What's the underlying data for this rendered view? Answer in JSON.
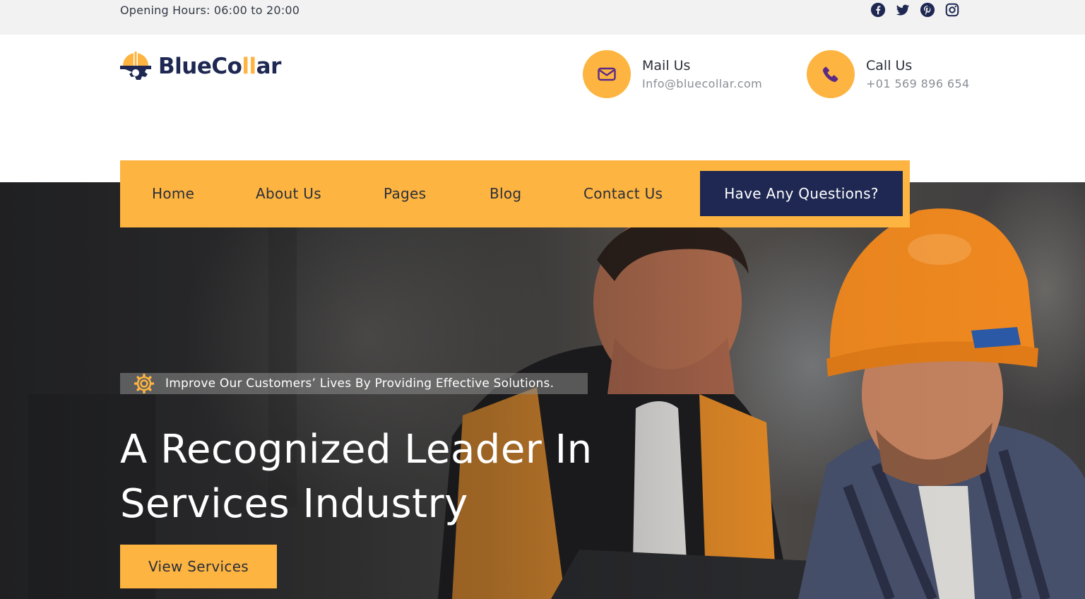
{
  "topbar": {
    "opening_hours": "Opening Hours: 06:00 to 20:00",
    "social": [
      "facebook-icon",
      "twitter-icon",
      "pinterest-icon",
      "instagram-icon"
    ]
  },
  "brand": {
    "name_part1": "BlueCo",
    "name_accent": "ll",
    "name_part2": "ar",
    "colors": {
      "navy": "#1e2852",
      "accent": "#fdb441"
    }
  },
  "contacts": {
    "mail": {
      "icon": "envelope-icon",
      "title": "Mail Us",
      "value": "Info@bluecollar.com"
    },
    "call": {
      "icon": "phone-icon",
      "title": "Call Us",
      "value": "+01 569 896 654"
    }
  },
  "nav": {
    "items": [
      {
        "label": "Home"
      },
      {
        "label": "About Us"
      },
      {
        "label": "Pages"
      },
      {
        "label": "Blog"
      },
      {
        "label": "Contact Us"
      }
    ],
    "cta": "Have Any Questions?"
  },
  "hero": {
    "tagline_icon": "gear-icon",
    "tagline": "Improve Our Customers’ Lives By Providing Effective Solutions.",
    "headline_line1": "A Recognized Leader In",
    "headline_line2": "Services Industry",
    "button": "View Services"
  }
}
